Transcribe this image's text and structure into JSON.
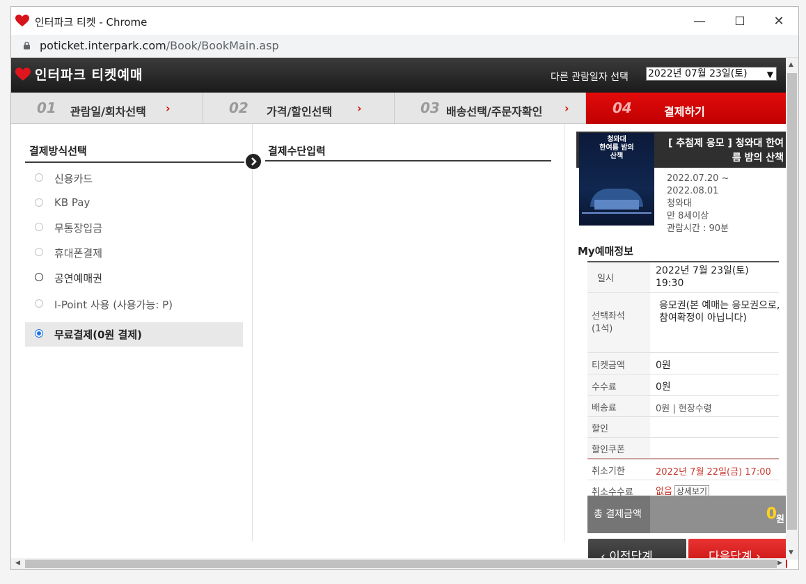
{
  "window": {
    "title": "인터파크 티켓 - Chrome",
    "minimize": "—",
    "maximize": "☐",
    "close": "✕"
  },
  "url": {
    "domain": "poticket.interpark.com",
    "path": "/Book/BookMain.asp"
  },
  "header": {
    "brand": "인터파크 티켓예매",
    "date_label": "다른 관람일자 선택",
    "date_value": "2022년 07월 23일(토)"
  },
  "steps": [
    {
      "num": "01",
      "label": "관람일/회차선택",
      "arrow": "›"
    },
    {
      "num": "02",
      "label": "가격/할인선택",
      "arrow": "›"
    },
    {
      "num": "03",
      "label": "배송선택/주문자확인",
      "arrow": "›"
    },
    {
      "num": "04",
      "label": "결제하기"
    }
  ],
  "left": {
    "title": "결제방식선택",
    "options": [
      {
        "label": "신용카드"
      },
      {
        "label": "KB Pay"
      },
      {
        "label": "무통장입금"
      },
      {
        "label": "휴대폰결제"
      },
      {
        "label": "공연예매권"
      },
      {
        "label": "I-Point 사용 (사용가능: P)"
      },
      {
        "label": "무료결제(0원 결제)"
      }
    ]
  },
  "middle": {
    "title": "결제수단입력"
  },
  "show": {
    "poster_text": "청와대\n한여름 밤의\n산책",
    "title": "[ 추첨제 응모 ] 청와대 한여름 밤의 산책",
    "period_start": "2022.07.20 ~",
    "period_end": "2022.08.01",
    "venue": "청와대",
    "age": "만 8세이상",
    "runtime": "관람시간 : 90분"
  },
  "my_info": {
    "title": "My예매정보",
    "datetime_label": "일시",
    "datetime_value": "2022년 7월 23일(토) 19:30",
    "seat_label": "선택좌석\n(1석)",
    "seat_value": "응모권(본 예매는 응모권으로, 참여확정이 아닙니다)",
    "ticket_label": "티켓금액",
    "ticket_value": "0원",
    "fee_label": "수수료",
    "fee_value": "0원",
    "delivery_label": "배송료",
    "delivery_value": "0원 | 현장수령",
    "discount_label": "할인",
    "coupon_label": "할인쿠폰",
    "cancel_deadline_label": "취소기한",
    "cancel_deadline_value": "2022년 7월 22일(금) 17:00",
    "cancel_fee_label": "취소수수료",
    "cancel_fee_value": "없음",
    "detail_button": "상세보기",
    "total_label": "총 결제금액",
    "total_amount": "0",
    "total_unit": "원"
  },
  "buttons": {
    "prev": "‹  이전단계",
    "next": "다음단계  ›"
  }
}
